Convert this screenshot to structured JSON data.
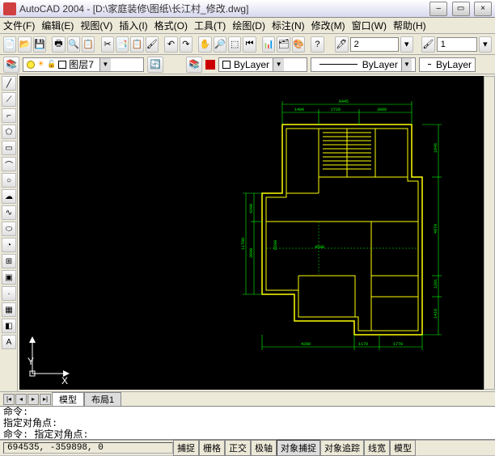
{
  "title": "AutoCAD 2004 - [D:\\家庭装修\\图纸\\长江村_修改.dwg]",
  "menu": [
    "文件(F)",
    "编辑(E)",
    "视图(V)",
    "插入(I)",
    "格式(O)",
    "工具(T)",
    "绘图(D)",
    "标注(N)",
    "修改(M)",
    "窗口(W)",
    "帮助(H)"
  ],
  "toolbar1": {
    "linetype_val": "2",
    "lineweight_val": "1"
  },
  "layerbar": {
    "layer": "图层7",
    "style1": "ByLayer",
    "style2": "ByLayer",
    "style3": "ByLayer"
  },
  "tabs": {
    "model": "模型",
    "layout1": "布局1"
  },
  "cmd": {
    "l1": "命令:",
    "l2": "指定对角点:",
    "l3": "命令: 指定对角点:"
  },
  "status": {
    "coord": "694535, -359898, 0",
    "btns": [
      "捕捉",
      "栅格",
      "正交",
      "极轴",
      "对象捕捉",
      "对象追踪",
      "线宽",
      "模型"
    ]
  },
  "ucs": {
    "y": "Y",
    "x": "X"
  },
  "dims": {
    "top_total": "8445",
    "t1": "1400",
    "t2": "2720",
    "t3": "3009",
    "b1": "4200",
    "b2": "1179",
    "b3": "1770",
    "l_total": "11700",
    "l1": "4200",
    "l2": "3600",
    "r1": "1846",
    "r2": "4970",
    "r3": "1201",
    "r4": "1410",
    "m1": "4590",
    "m2": "6500"
  }
}
